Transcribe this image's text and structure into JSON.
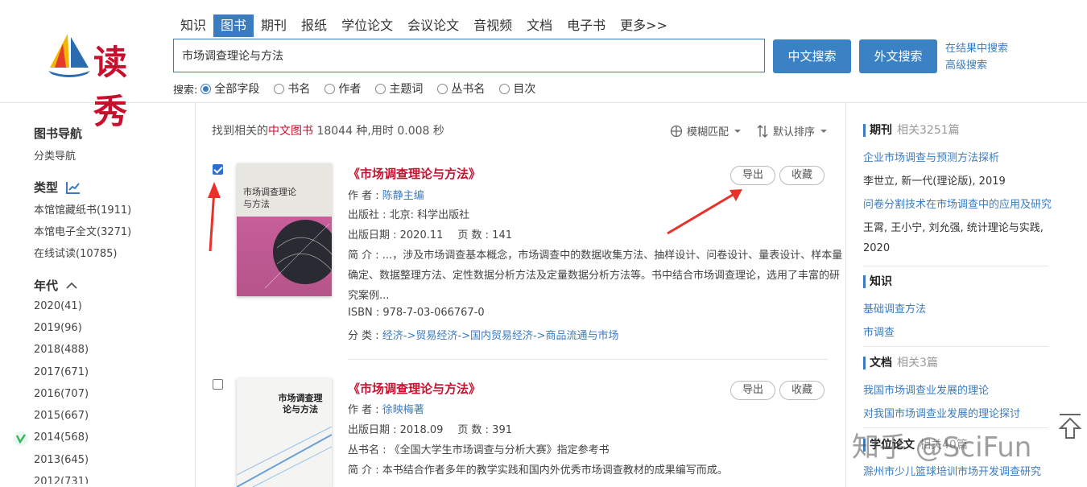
{
  "header": {
    "logo_text": "读秀",
    "tabs": [
      "知识",
      "图书",
      "期刊",
      "报纸",
      "学位论文",
      "会议论文",
      "音视频",
      "文档",
      "电子书",
      "更多>>"
    ],
    "active_tab": "图书",
    "search_value": "市场调查理论与方法",
    "cn_search": "中文搜索",
    "en_search": "外文搜索",
    "in_result": "在结果中搜索",
    "advanced": "高级搜索",
    "field_label": "搜索:",
    "fields": [
      "全部字段",
      "书名",
      "作者",
      "主题词",
      "丛书名",
      "目次"
    ],
    "selected_field": "全部字段"
  },
  "leftnav": {
    "title1": "图书导航",
    "sub1": "分类导航",
    "title2": "类型",
    "types": [
      "本馆馆藏纸书(1911)",
      "本馆电子全文(3271)",
      "在线试读(10785)"
    ],
    "title3": "年代",
    "years": [
      "2020(41)",
      "2019(96)",
      "2018(488)",
      "2017(671)",
      "2016(707)",
      "2015(667)",
      "2014(568)",
      "2013(645)",
      "2012(731)"
    ]
  },
  "main": {
    "summary_pre": "找到相关的",
    "summary_type": "中文图书",
    "summary_post": " 18044 种,用时 0.008 秒",
    "fuzzy": "模糊匹配",
    "sort": "默认排序",
    "export": "导出",
    "collect": "收藏",
    "results": [
      {
        "title": "《市场调查理论与方法》",
        "author_label": "作 者 :",
        "author": "陈静主编",
        "publisher": "出版社 : 北京: 科学出版社",
        "date": "出版日期 : 2020.11",
        "pages": "页 数 : 141",
        "abstract_label": "简 介 :",
        "abstract_1": "...，涉及市场调查基本概念，市场调查中的数据收集方法、抽样设计、问卷设计、量表设计、样本量",
        "abstract_2": "确定、数据整理方法、定性数据分析方法及定量数据分析方法等。书中结合市场调查理论，选用了丰富的研",
        "abstract_3": "究案例...",
        "isbn": "ISBN : 978-7-03-066767-0",
        "class_label": "分 类 :",
        "class_path": "经济->贸易经济->国内贸易经济->商品流通与市场",
        "cover_title": "市场调查理论与方法",
        "checked": true
      },
      {
        "title": "《市场调查理论与方法》",
        "author_label": "作 者 :",
        "author": "徐映梅著",
        "date": "出版日期 : 2018.09",
        "pages": "页 数 : 391",
        "series": "丛书名 : 《全国大学生市场调查与分析大赛》指定参考书",
        "abstract_label": "简 介 :",
        "abstract_1": "本书结合作者多年的教学实践和国内外优秀市场调查教材的成果编写而成。",
        "cover_title": "市场调查理论与方法",
        "checked": false
      }
    ]
  },
  "right": {
    "sec1": {
      "title": "期刊",
      "count": "相关3251篇"
    },
    "j1": "企业市场调查与预测方法探析",
    "j1_meta": "李世立, 新一代(理论版), 2019",
    "j2": "问卷分割技术在市场调查中的应用及研究",
    "j2_meta_1": "王霄, 王小宁, 刘允强, 统计理论与实践,",
    "j2_meta_2": "2020",
    "sec2": {
      "title": "知识"
    },
    "k1": "基础调查方法",
    "k2": "市调查",
    "sec3": {
      "title": "文档",
      "count": "相关3篇"
    },
    "d1": "我国市场调查业发展的理论",
    "d2": "对我国市场调查业发展的理论探讨",
    "sec4": {
      "title": "学位论文",
      "count": "相关40篇"
    },
    "t1": "滁州市少儿篮球培训市场开发调查研究"
  },
  "watermark": "知乎 @SciFun",
  "colors": {
    "accent": "#3b7cc0",
    "highlight": "#c8102e",
    "arrow": "#e8312a"
  }
}
